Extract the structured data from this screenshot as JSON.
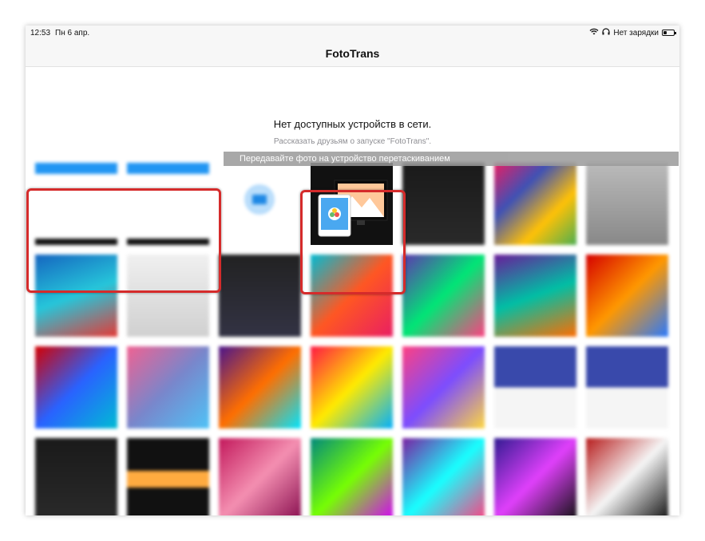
{
  "status": {
    "time": "12:53",
    "date": "Пн 6 апр.",
    "charging": "Нет зарядки",
    "battery_level": 0.35
  },
  "nav": {
    "title": "FotoTrans"
  },
  "empty_state": {
    "title": "Нет доступных устройств в сети.",
    "subtitle": "Рассказать друзьям о запуске  \"FotoTrans\"."
  },
  "drag_hint": "Передавайте фото на устройство перетаскиванием",
  "colors": {
    "highlight": "#d52b2b",
    "accent": "#1e88e5"
  },
  "thumbnails": [
    {
      "kind": "screenshot-app"
    },
    {
      "kind": "screenshot-settings"
    },
    {
      "kind": "screenshot-icon"
    },
    {
      "kind": "fototrans-logo"
    },
    {
      "kind": "dark-ui"
    },
    {
      "kind": "colorful-grid"
    },
    {
      "kind": "gray-ui"
    },
    {
      "kind": "blue-wallpaper"
    },
    {
      "kind": "settings-list"
    },
    {
      "kind": "dark-list"
    },
    {
      "kind": "rainbow"
    },
    {
      "kind": "purple-green"
    },
    {
      "kind": "purple-wave"
    },
    {
      "kind": "orange-wave"
    },
    {
      "kind": "red-blue"
    },
    {
      "kind": "pink-blue"
    },
    {
      "kind": "purple-orange"
    },
    {
      "kind": "pink-yellow"
    },
    {
      "kind": "pink-purple"
    },
    {
      "kind": "blue-card"
    },
    {
      "kind": "blue-card"
    },
    {
      "kind": "dark-ui"
    },
    {
      "kind": "orange-dark"
    },
    {
      "kind": "pink-wave"
    },
    {
      "kind": "teal-wave"
    },
    {
      "kind": "purple-teal"
    },
    {
      "kind": "purple-dark"
    },
    {
      "kind": "red-dark"
    }
  ]
}
